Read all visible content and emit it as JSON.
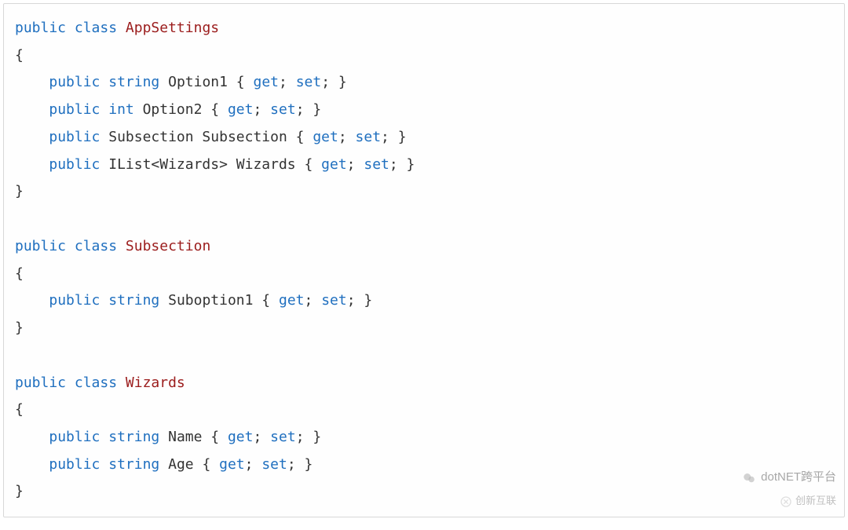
{
  "code": {
    "lines": [
      {
        "tokens": [
          {
            "t": "public",
            "c": "kw"
          },
          {
            "t": " ",
            "c": "pl"
          },
          {
            "t": "class",
            "c": "kw"
          },
          {
            "t": " ",
            "c": "pl"
          },
          {
            "t": "AppSettings",
            "c": "ty"
          }
        ]
      },
      {
        "tokens": [
          {
            "t": "{",
            "c": "pl"
          }
        ]
      },
      {
        "tokens": [
          {
            "t": "    ",
            "c": "pl"
          },
          {
            "t": "public",
            "c": "kw"
          },
          {
            "t": " ",
            "c": "pl"
          },
          {
            "t": "string",
            "c": "kw"
          },
          {
            "t": " Option1 { ",
            "c": "pl"
          },
          {
            "t": "get",
            "c": "kw"
          },
          {
            "t": "; ",
            "c": "pl"
          },
          {
            "t": "set",
            "c": "kw"
          },
          {
            "t": "; }",
            "c": "pl"
          }
        ]
      },
      {
        "tokens": [
          {
            "t": "    ",
            "c": "pl"
          },
          {
            "t": "public",
            "c": "kw"
          },
          {
            "t": " ",
            "c": "pl"
          },
          {
            "t": "int",
            "c": "kw"
          },
          {
            "t": " Option2 { ",
            "c": "pl"
          },
          {
            "t": "get",
            "c": "kw"
          },
          {
            "t": "; ",
            "c": "pl"
          },
          {
            "t": "set",
            "c": "kw"
          },
          {
            "t": "; }",
            "c": "pl"
          }
        ]
      },
      {
        "tokens": [
          {
            "t": "    ",
            "c": "pl"
          },
          {
            "t": "public",
            "c": "kw"
          },
          {
            "t": " Subsection Subsection { ",
            "c": "pl"
          },
          {
            "t": "get",
            "c": "kw"
          },
          {
            "t": "; ",
            "c": "pl"
          },
          {
            "t": "set",
            "c": "kw"
          },
          {
            "t": "; }",
            "c": "pl"
          }
        ]
      },
      {
        "tokens": [
          {
            "t": "    ",
            "c": "pl"
          },
          {
            "t": "public",
            "c": "kw"
          },
          {
            "t": " IList<Wizards> Wizards { ",
            "c": "pl"
          },
          {
            "t": "get",
            "c": "kw"
          },
          {
            "t": "; ",
            "c": "pl"
          },
          {
            "t": "set",
            "c": "kw"
          },
          {
            "t": "; }",
            "c": "pl"
          }
        ]
      },
      {
        "tokens": [
          {
            "t": "}",
            "c": "pl"
          }
        ]
      },
      {
        "tokens": [
          {
            "t": "",
            "c": "pl"
          }
        ]
      },
      {
        "tokens": [
          {
            "t": "public",
            "c": "kw"
          },
          {
            "t": " ",
            "c": "pl"
          },
          {
            "t": "class",
            "c": "kw"
          },
          {
            "t": " ",
            "c": "pl"
          },
          {
            "t": "Subsection",
            "c": "ty"
          }
        ]
      },
      {
        "tokens": [
          {
            "t": "{",
            "c": "pl"
          }
        ]
      },
      {
        "tokens": [
          {
            "t": "    ",
            "c": "pl"
          },
          {
            "t": "public",
            "c": "kw"
          },
          {
            "t": " ",
            "c": "pl"
          },
          {
            "t": "string",
            "c": "kw"
          },
          {
            "t": " Suboption1 { ",
            "c": "pl"
          },
          {
            "t": "get",
            "c": "kw"
          },
          {
            "t": "; ",
            "c": "pl"
          },
          {
            "t": "set",
            "c": "kw"
          },
          {
            "t": "; }",
            "c": "pl"
          }
        ]
      },
      {
        "tokens": [
          {
            "t": "}",
            "c": "pl"
          }
        ]
      },
      {
        "tokens": [
          {
            "t": "",
            "c": "pl"
          }
        ]
      },
      {
        "tokens": [
          {
            "t": "public",
            "c": "kw"
          },
          {
            "t": " ",
            "c": "pl"
          },
          {
            "t": "class",
            "c": "kw"
          },
          {
            "t": " ",
            "c": "pl"
          },
          {
            "t": "Wizards",
            "c": "ty"
          }
        ]
      },
      {
        "tokens": [
          {
            "t": "{",
            "c": "pl"
          }
        ]
      },
      {
        "tokens": [
          {
            "t": "    ",
            "c": "pl"
          },
          {
            "t": "public",
            "c": "kw"
          },
          {
            "t": " ",
            "c": "pl"
          },
          {
            "t": "string",
            "c": "kw"
          },
          {
            "t": " Name { ",
            "c": "pl"
          },
          {
            "t": "get",
            "c": "kw"
          },
          {
            "t": "; ",
            "c": "pl"
          },
          {
            "t": "set",
            "c": "kw"
          },
          {
            "t": "; }",
            "c": "pl"
          }
        ]
      },
      {
        "tokens": [
          {
            "t": "    ",
            "c": "pl"
          },
          {
            "t": "public",
            "c": "kw"
          },
          {
            "t": " ",
            "c": "pl"
          },
          {
            "t": "string",
            "c": "kw"
          },
          {
            "t": " Age { ",
            "c": "pl"
          },
          {
            "t": "get",
            "c": "kw"
          },
          {
            "t": "; ",
            "c": "pl"
          },
          {
            "t": "set",
            "c": "kw"
          },
          {
            "t": "; }",
            "c": "pl"
          }
        ]
      },
      {
        "tokens": [
          {
            "t": "}",
            "c": "pl"
          }
        ]
      }
    ]
  },
  "watermark": {
    "line1": "dotNET跨平台",
    "line2": "创新互联"
  }
}
